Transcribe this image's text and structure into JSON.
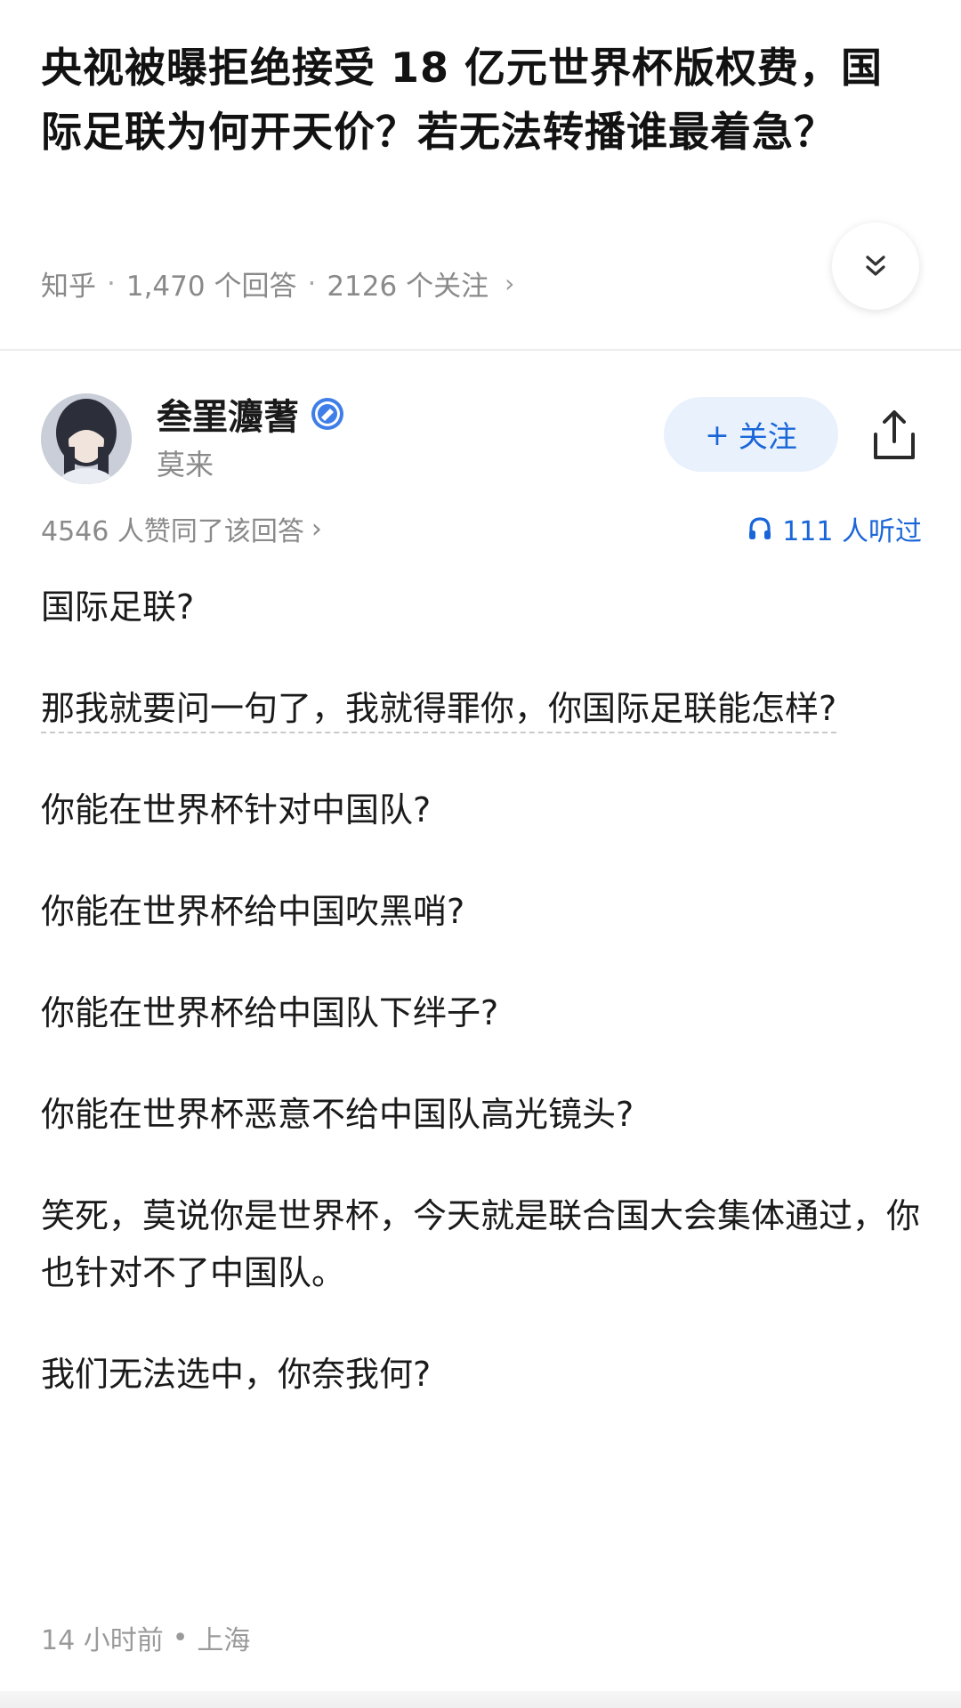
{
  "question": {
    "title": "央视被曝拒绝接受 18 亿元世界杯版权费，国际足联为何开天价？若无法转播谁最着急？",
    "source": "知乎",
    "answers": "1,470 个回答",
    "follows": "2126 个关注",
    "sep": "·"
  },
  "author": {
    "name": "叁罣灋蓍",
    "subtitle": "莫来",
    "follow_label": "关注",
    "follow_plus": "+"
  },
  "stats": {
    "likes": "4546 人赞同了该回答",
    "listened": "111 人听过"
  },
  "answer": {
    "paragraphs": [
      "国际足联?",
      "那我就要问一句了，我就得罪你，你国际足联能怎样?",
      "你能在世界杯针对中国队?",
      "你能在世界杯给中国吹黑哨?",
      "你能在世界杯给中国队下绊子?",
      "你能在世界杯恶意不给中国队高光镜头?",
      "笑死，莫说你是世界杯，今天就是联合国大会集体通过，你也针对不了中国队。",
      "我们无法选中，你奈我何?"
    ]
  },
  "footer": {
    "time": "14 小时前",
    "dot": "•",
    "location": "上海"
  },
  "colors": {
    "accent": "#1a66d8",
    "follow_bg": "#e9f1fd",
    "meta": "#8a8a8a"
  },
  "icons": {
    "collapse": "double-chevron-down-icon",
    "share": "share-icon",
    "verified": "verified-badge-icon",
    "headphones": "headphones-icon"
  }
}
